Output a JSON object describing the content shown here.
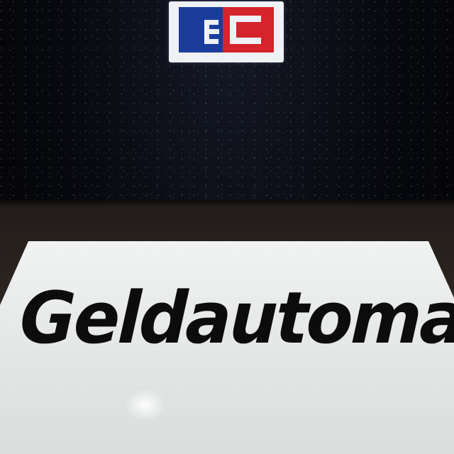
{
  "scene": {
    "logo": {
      "name": "ec-logo",
      "colors": {
        "left": "#1c3c9c",
        "right": "#d6242c",
        "background": "#eef1f6"
      }
    },
    "sign": {
      "text": "Geldautomat",
      "text_color": "#0c0c0c",
      "panel_color": "#e6e9e8"
    }
  }
}
